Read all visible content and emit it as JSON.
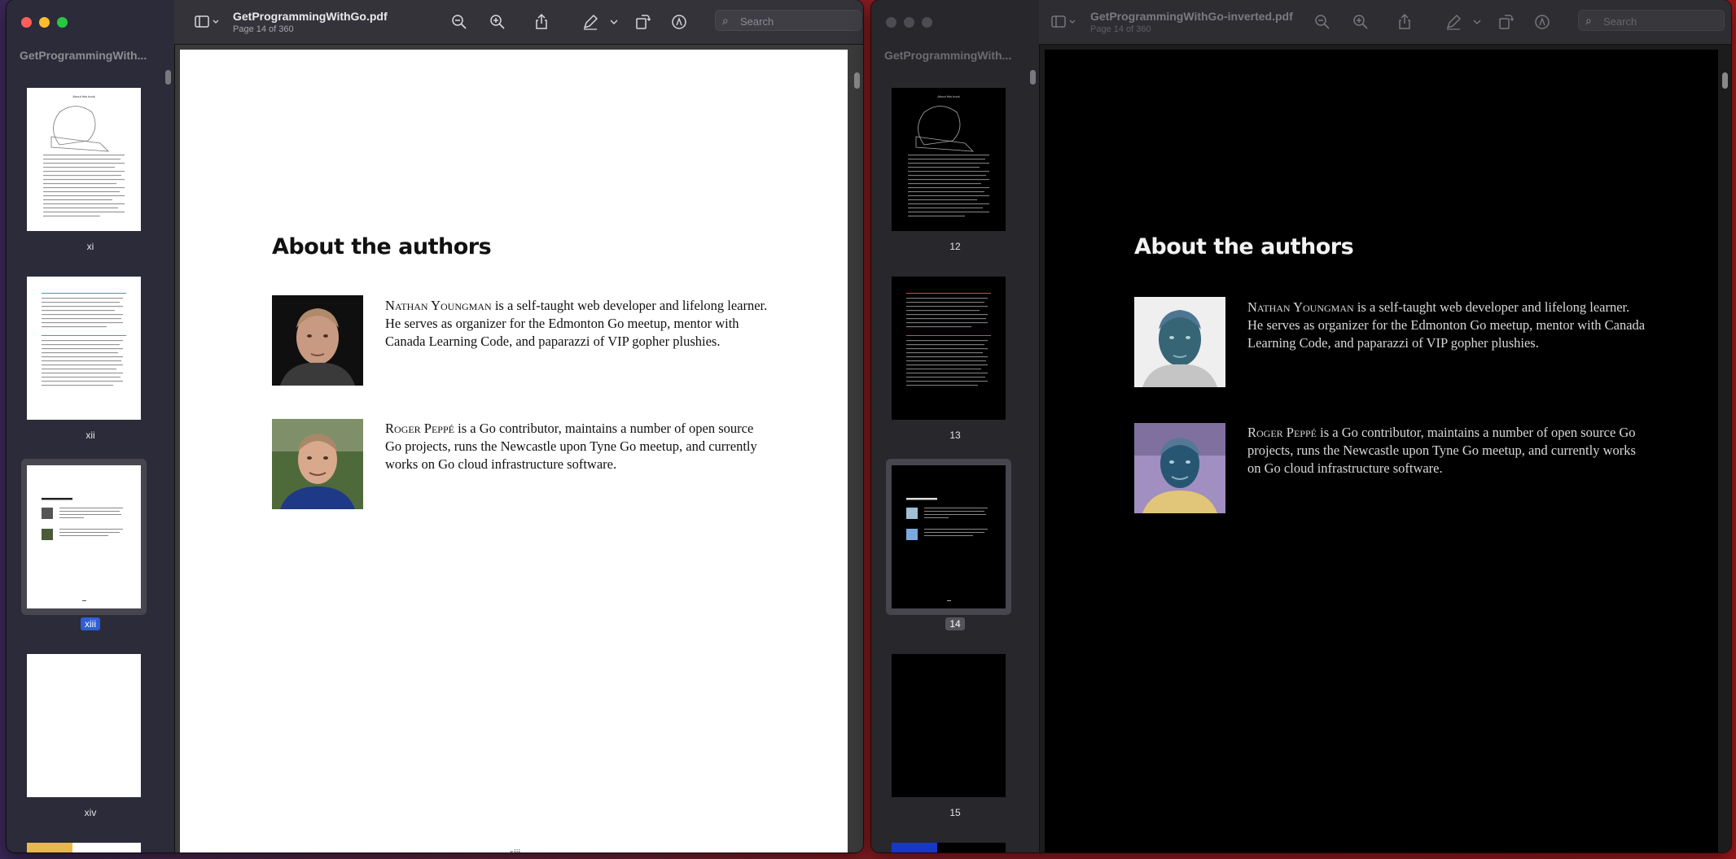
{
  "windows": [
    {
      "sidebar_title": "GetProgrammingWith...",
      "doc_title": "GetProgrammingWithGo.pdf",
      "doc_subtitle": "Page 14 of 360",
      "search_placeholder": "Search",
      "thumbnails": [
        {
          "label": "xi"
        },
        {
          "label": "xii"
        },
        {
          "label": "xiii",
          "selected": true
        },
        {
          "label": "xiv"
        }
      ],
      "page": {
        "heading": "About the authors",
        "authors": [
          {
            "name": "Nathan Youngman",
            "bio": " is a self-taught web developer and lifelong learner. He serves as organizer for the Edmonton Go meetup, mentor with Canada Learning Code, and paparazzi of VIP gopher plushies."
          },
          {
            "name": "Roger Peppé",
            "bio": " is a Go contributor, maintains a number of open source Go projects, runs the Newcastle upon Tyne Go meetup, and currently works on Go cloud infrastructure software."
          }
        ],
        "page_number": "xiii"
      }
    },
    {
      "sidebar_title": "GetProgrammingWith...",
      "doc_title": "GetProgrammingWithGo-inverted.pdf",
      "doc_subtitle": "Page 14 of 360",
      "search_placeholder": "Search",
      "thumbnails": [
        {
          "label": "12"
        },
        {
          "label": "13"
        },
        {
          "label": "14",
          "selected": true
        },
        {
          "label": "15"
        }
      ],
      "page": {
        "heading": "About the authors",
        "authors": [
          {
            "name": "Nathan Youngman",
            "bio": " is a self-taught web developer and lifelong learner. He serves as organizer for the Edmonton Go meetup, mentor with Canada Learning Code, and paparazzi of VIP gopher plushies."
          },
          {
            "name": "Roger Peppé",
            "bio": " is a Go contributor, maintains a number of open source Go projects, runs the Newcastle upon Tyne Go meetup, and currently works on Go cloud infrastructure software."
          }
        ]
      }
    }
  ],
  "icons": {
    "sidebar_toggle": "sidebar-icon",
    "zoom_out": "zoom-out-icon",
    "zoom_in": "zoom-in-icon",
    "share": "share-icon",
    "markup": "pencil-icon",
    "rotate": "rotate-icon",
    "annotate": "markup-icon",
    "search": "search-icon"
  },
  "colors": {
    "selection": "#2f5ed6",
    "close": "#ff5f57",
    "minimize": "#febc2e",
    "zoom": "#28c840"
  }
}
